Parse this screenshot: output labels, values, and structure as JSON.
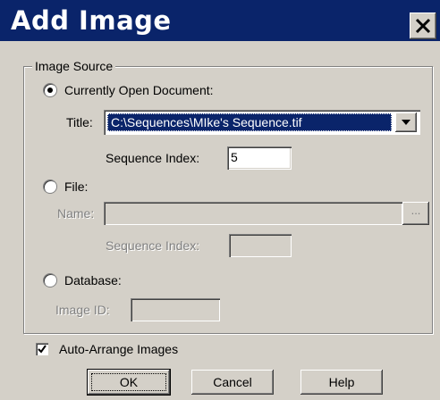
{
  "dialog": {
    "title": "Add Image",
    "close_glyph": "×"
  },
  "image_source": {
    "group_label": "Image Source",
    "current_document": {
      "label": "Currently Open Document:",
      "selected": true,
      "title_label": "Title:",
      "title_value": "C:\\Sequences\\MIke's Sequence.tif",
      "sequence_index_label": "Sequence Index:",
      "sequence_index_value": "5"
    },
    "file": {
      "label": "File:",
      "selected": false,
      "name_label": "Name:",
      "name_value": "",
      "browse_label": "...",
      "sequence_index_label": "Sequence Index:",
      "sequence_index_value": ""
    },
    "database": {
      "label": "Database:",
      "selected": false,
      "image_id_label": "Image ID:",
      "image_id_value": ""
    }
  },
  "auto_arrange": {
    "label": "Auto-Arrange Images",
    "checked": true
  },
  "buttons": {
    "ok": "OK",
    "cancel": "Cancel",
    "help": "Help"
  },
  "colors": {
    "titlebar": "#0a246a",
    "face": "#d4d0c8",
    "selection": "#0a246a"
  }
}
